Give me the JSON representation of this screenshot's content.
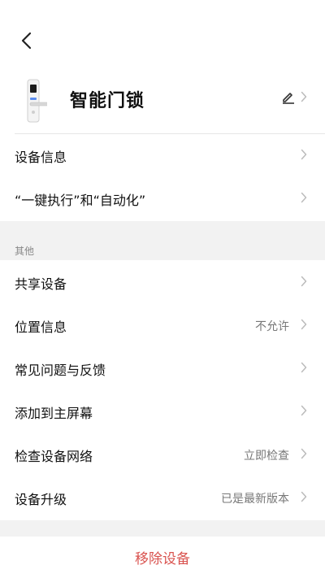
{
  "header": {
    "back_icon": "chevron-left-icon",
    "device_name": "智能门锁",
    "edit_icon": "pencil-icon"
  },
  "group1": [
    {
      "label": "设备信息",
      "value": ""
    },
    {
      "label": "“一键执行”和“自动化”",
      "value": ""
    }
  ],
  "section_other": {
    "title": "其他",
    "items": [
      {
        "label": "共享设备",
        "value": ""
      },
      {
        "label": "位置信息",
        "value": "不允许"
      },
      {
        "label": "常见问题与反馈",
        "value": ""
      },
      {
        "label": "添加到主屏幕",
        "value": ""
      },
      {
        "label": "检查设备网络",
        "value": "立即检查"
      },
      {
        "label": "设备升级",
        "value": "已是最新版本"
      }
    ]
  },
  "footer": {
    "remove_label": "移除设备"
  },
  "colors": {
    "accent_red": "#d9534f",
    "band_gray": "#f2f2f2",
    "secondary_text": "#777777"
  }
}
